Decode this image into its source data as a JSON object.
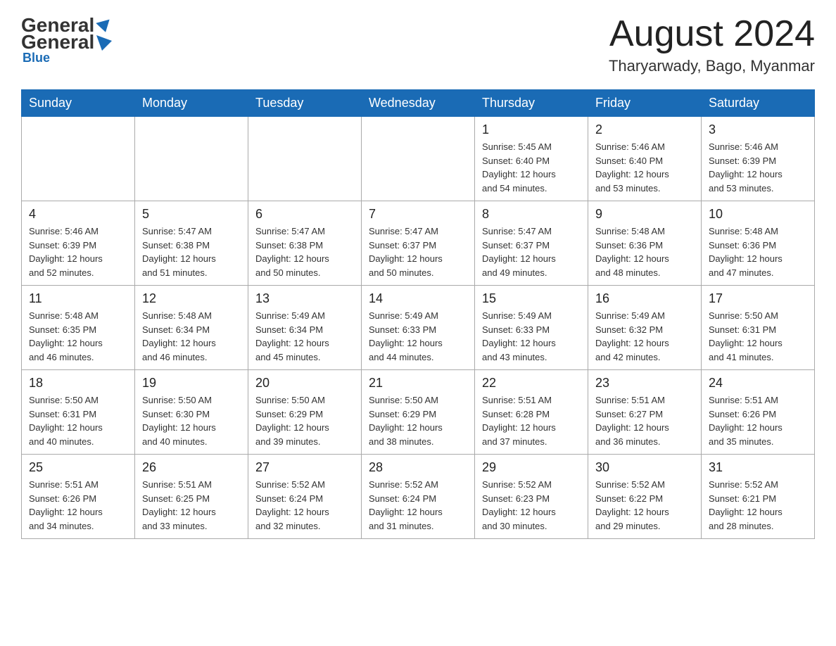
{
  "header": {
    "logo_general": "General",
    "logo_blue": "Blue",
    "month_title": "August 2024",
    "location": "Tharyarwady, Bago, Myanmar"
  },
  "days_of_week": [
    "Sunday",
    "Monday",
    "Tuesday",
    "Wednesday",
    "Thursday",
    "Friday",
    "Saturday"
  ],
  "weeks": [
    [
      {
        "day": "",
        "info": ""
      },
      {
        "day": "",
        "info": ""
      },
      {
        "day": "",
        "info": ""
      },
      {
        "day": "",
        "info": ""
      },
      {
        "day": "1",
        "info": "Sunrise: 5:45 AM\nSunset: 6:40 PM\nDaylight: 12 hours\nand 54 minutes."
      },
      {
        "day": "2",
        "info": "Sunrise: 5:46 AM\nSunset: 6:40 PM\nDaylight: 12 hours\nand 53 minutes."
      },
      {
        "day": "3",
        "info": "Sunrise: 5:46 AM\nSunset: 6:39 PM\nDaylight: 12 hours\nand 53 minutes."
      }
    ],
    [
      {
        "day": "4",
        "info": "Sunrise: 5:46 AM\nSunset: 6:39 PM\nDaylight: 12 hours\nand 52 minutes."
      },
      {
        "day": "5",
        "info": "Sunrise: 5:47 AM\nSunset: 6:38 PM\nDaylight: 12 hours\nand 51 minutes."
      },
      {
        "day": "6",
        "info": "Sunrise: 5:47 AM\nSunset: 6:38 PM\nDaylight: 12 hours\nand 50 minutes."
      },
      {
        "day": "7",
        "info": "Sunrise: 5:47 AM\nSunset: 6:37 PM\nDaylight: 12 hours\nand 50 minutes."
      },
      {
        "day": "8",
        "info": "Sunrise: 5:47 AM\nSunset: 6:37 PM\nDaylight: 12 hours\nand 49 minutes."
      },
      {
        "day": "9",
        "info": "Sunrise: 5:48 AM\nSunset: 6:36 PM\nDaylight: 12 hours\nand 48 minutes."
      },
      {
        "day": "10",
        "info": "Sunrise: 5:48 AM\nSunset: 6:36 PM\nDaylight: 12 hours\nand 47 minutes."
      }
    ],
    [
      {
        "day": "11",
        "info": "Sunrise: 5:48 AM\nSunset: 6:35 PM\nDaylight: 12 hours\nand 46 minutes."
      },
      {
        "day": "12",
        "info": "Sunrise: 5:48 AM\nSunset: 6:34 PM\nDaylight: 12 hours\nand 46 minutes."
      },
      {
        "day": "13",
        "info": "Sunrise: 5:49 AM\nSunset: 6:34 PM\nDaylight: 12 hours\nand 45 minutes."
      },
      {
        "day": "14",
        "info": "Sunrise: 5:49 AM\nSunset: 6:33 PM\nDaylight: 12 hours\nand 44 minutes."
      },
      {
        "day": "15",
        "info": "Sunrise: 5:49 AM\nSunset: 6:33 PM\nDaylight: 12 hours\nand 43 minutes."
      },
      {
        "day": "16",
        "info": "Sunrise: 5:49 AM\nSunset: 6:32 PM\nDaylight: 12 hours\nand 42 minutes."
      },
      {
        "day": "17",
        "info": "Sunrise: 5:50 AM\nSunset: 6:31 PM\nDaylight: 12 hours\nand 41 minutes."
      }
    ],
    [
      {
        "day": "18",
        "info": "Sunrise: 5:50 AM\nSunset: 6:31 PM\nDaylight: 12 hours\nand 40 minutes."
      },
      {
        "day": "19",
        "info": "Sunrise: 5:50 AM\nSunset: 6:30 PM\nDaylight: 12 hours\nand 40 minutes."
      },
      {
        "day": "20",
        "info": "Sunrise: 5:50 AM\nSunset: 6:29 PM\nDaylight: 12 hours\nand 39 minutes."
      },
      {
        "day": "21",
        "info": "Sunrise: 5:50 AM\nSunset: 6:29 PM\nDaylight: 12 hours\nand 38 minutes."
      },
      {
        "day": "22",
        "info": "Sunrise: 5:51 AM\nSunset: 6:28 PM\nDaylight: 12 hours\nand 37 minutes."
      },
      {
        "day": "23",
        "info": "Sunrise: 5:51 AM\nSunset: 6:27 PM\nDaylight: 12 hours\nand 36 minutes."
      },
      {
        "day": "24",
        "info": "Sunrise: 5:51 AM\nSunset: 6:26 PM\nDaylight: 12 hours\nand 35 minutes."
      }
    ],
    [
      {
        "day": "25",
        "info": "Sunrise: 5:51 AM\nSunset: 6:26 PM\nDaylight: 12 hours\nand 34 minutes."
      },
      {
        "day": "26",
        "info": "Sunrise: 5:51 AM\nSunset: 6:25 PM\nDaylight: 12 hours\nand 33 minutes."
      },
      {
        "day": "27",
        "info": "Sunrise: 5:52 AM\nSunset: 6:24 PM\nDaylight: 12 hours\nand 32 minutes."
      },
      {
        "day": "28",
        "info": "Sunrise: 5:52 AM\nSunset: 6:24 PM\nDaylight: 12 hours\nand 31 minutes."
      },
      {
        "day": "29",
        "info": "Sunrise: 5:52 AM\nSunset: 6:23 PM\nDaylight: 12 hours\nand 30 minutes."
      },
      {
        "day": "30",
        "info": "Sunrise: 5:52 AM\nSunset: 6:22 PM\nDaylight: 12 hours\nand 29 minutes."
      },
      {
        "day": "31",
        "info": "Sunrise: 5:52 AM\nSunset: 6:21 PM\nDaylight: 12 hours\nand 28 minutes."
      }
    ]
  ]
}
